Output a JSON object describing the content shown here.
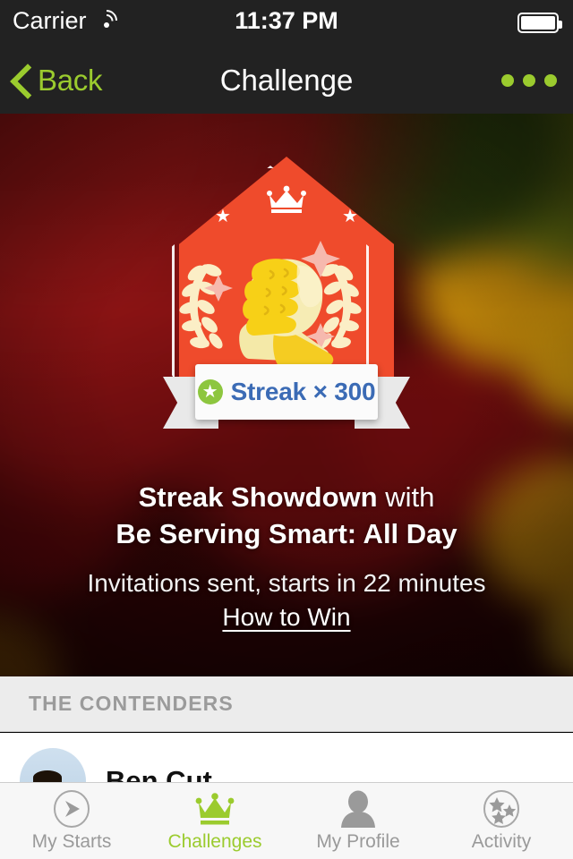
{
  "status_bar": {
    "carrier": "Carrier",
    "wifi_icon": "wifi-icon",
    "time": "11:37 PM",
    "battery_icon": "battery-full-icon"
  },
  "nav_bar": {
    "back_label": "Back",
    "back_icon": "chevron-left-icon",
    "title": "Challenge",
    "more_icon": "more-dots-icon"
  },
  "badge": {
    "crown_icon": "crown-icon",
    "star_left_icon": "star-icon",
    "star_right_icon": "star-icon",
    "emblem_icon": "clasped-hands-icon",
    "laurel_icon": "laurel-wreath-icon",
    "ribbon_star_icon": "star-badge-icon",
    "ribbon_text": "Streak × 300",
    "shield_color": "#ef4b2c",
    "ribbon_text_color": "#3b6bb5",
    "ribbon_star_color": "#8dc63f"
  },
  "hero": {
    "title_bold": "Streak Showdown",
    "title_regular": " with",
    "title_line2": "Be Serving Smart: All Day",
    "subtitle": "Invitations sent, starts in 22 minutes",
    "link": "How to Win"
  },
  "contenders": {
    "section_title": "THE CONTENDERS",
    "rows": [
      {
        "avatar_icon": "avatar-photo",
        "name": "Ben Cut"
      }
    ]
  },
  "tab_bar": {
    "accent_color": "#9bcb2e",
    "inactive_color": "#9a9a9a",
    "tabs": [
      {
        "label": "My Starts",
        "icon": "play-arrow-circle-icon",
        "active": false
      },
      {
        "label": "Challenges",
        "icon": "crown-icon",
        "active": true
      },
      {
        "label": "My Profile",
        "icon": "person-icon",
        "active": false
      },
      {
        "label": "Activity",
        "icon": "stars-circle-icon",
        "active": false
      }
    ]
  }
}
